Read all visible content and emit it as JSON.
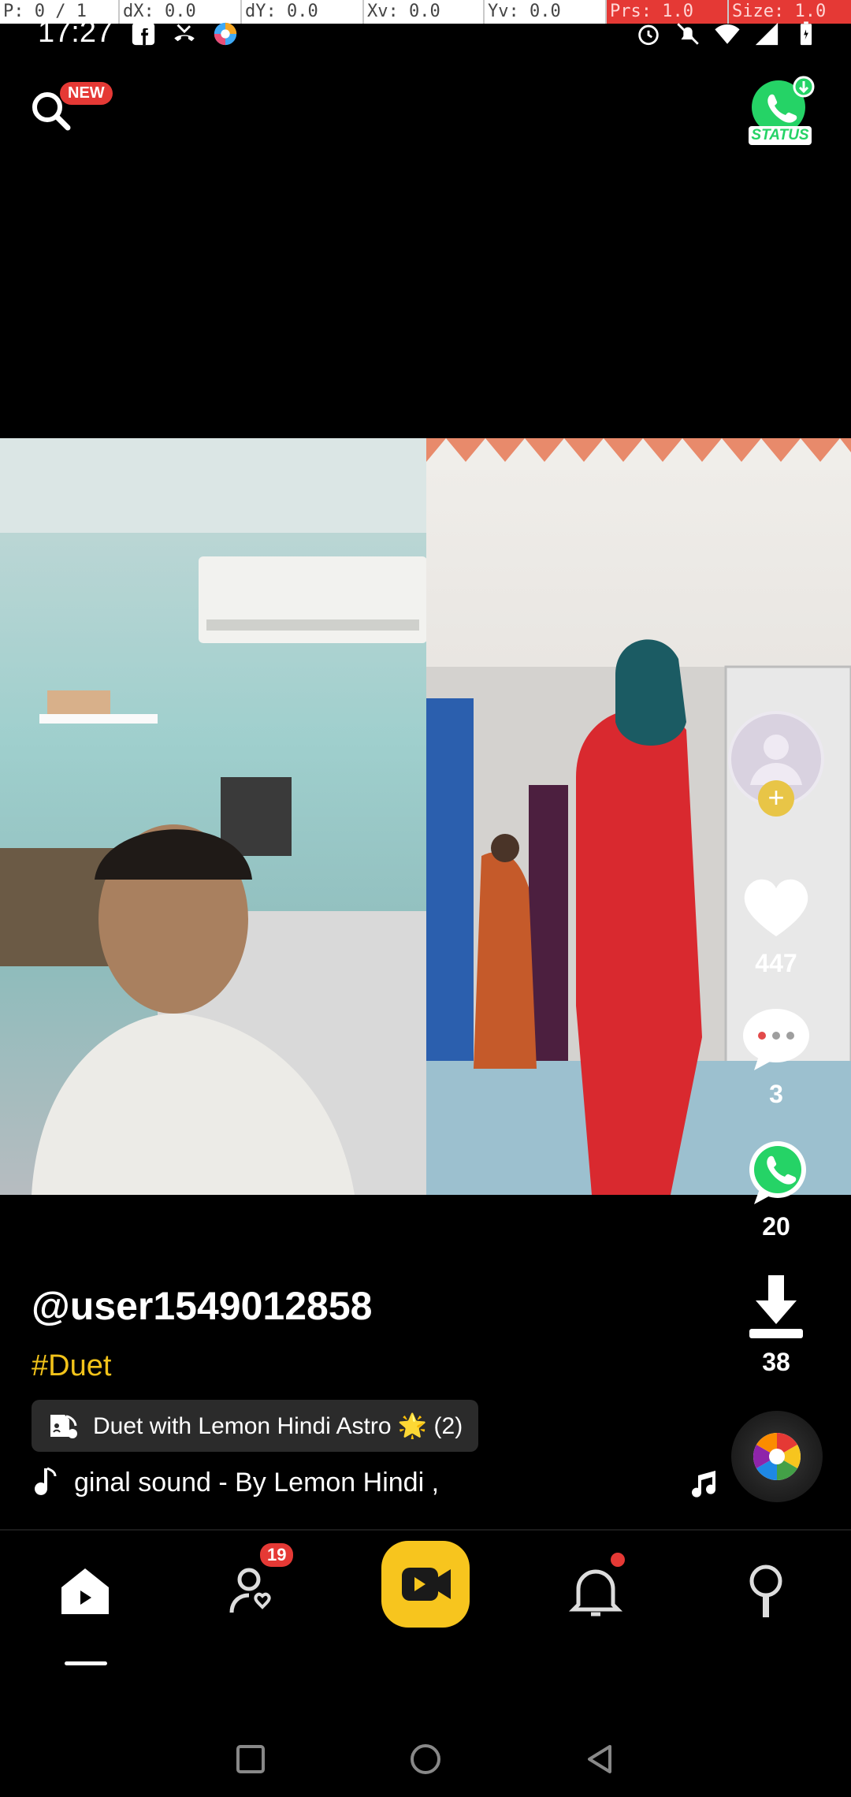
{
  "debug_bar": {
    "p": "P: 0 / 1",
    "dx": "dX: 0.0",
    "dy": "dY: 0.0",
    "xv": "Xv: 0.0",
    "yv": "Yv: 0.0",
    "prs": "Prs: 1.0",
    "size": "Size: 1.0"
  },
  "status_bar": {
    "time": "17:27",
    "left_icons": [
      "facebook-icon",
      "missed-call-icon",
      "app-icon"
    ],
    "right_icons": [
      "alarm-icon",
      "mute-icon",
      "wifi-icon",
      "signal-icon",
      "battery-icon"
    ]
  },
  "top_bar": {
    "new_badge": "NEW",
    "whatsapp_status_label": "STATUS"
  },
  "actions": {
    "likes": "447",
    "comments": "3",
    "shares": "20",
    "downloads": "38"
  },
  "post": {
    "username": "@user1549012858",
    "hashtag": "#Duet",
    "duet_label": "Duet with Lemon Hindi Astro 🌟 (2)",
    "sound": "ginal sound - By Lemon Hindi ,"
  },
  "bottom_nav": {
    "follow_badge": "19"
  },
  "colors": {
    "accent": "#f7c51e",
    "badge": "#e53935",
    "hashtag": "#f2c31a",
    "whatsapp": "#25d366"
  }
}
